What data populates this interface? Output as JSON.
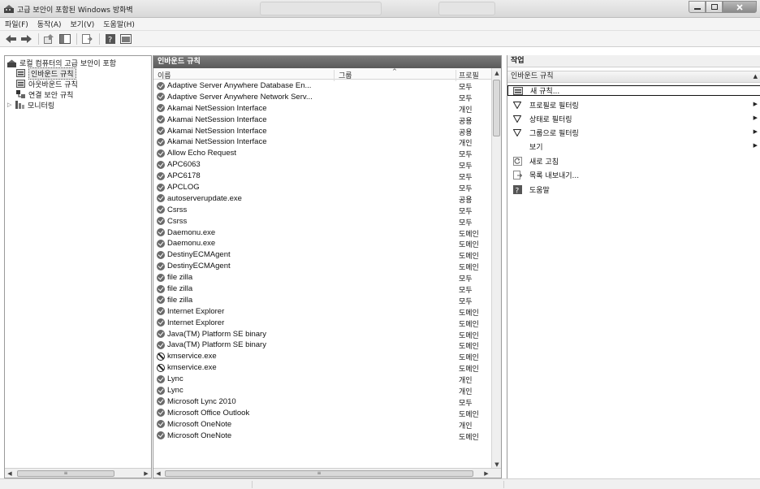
{
  "window": {
    "title": "고급 보안이 포함된 Windows 방화벽",
    "controls": [
      "minimize",
      "maximize",
      "close"
    ]
  },
  "menu": [
    "파일(F)",
    "동작(A)",
    "보기(V)",
    "도움말(H)"
  ],
  "toolbar": {
    "buttons": [
      "back-icon",
      "forward-icon",
      "up-icon",
      "show-hide-tree-icon",
      "export-icon",
      "help-icon",
      "console-icon"
    ]
  },
  "tree": {
    "root": "로컬 컴퓨터의 고급 보안이 포함",
    "items": [
      {
        "label": "인바운드 규칙",
        "selected": true,
        "icon": "inbound-rules-icon"
      },
      {
        "label": "아웃바운드 규칙",
        "selected": false,
        "icon": "outbound-rules-icon"
      },
      {
        "label": "연결 보안 규칙",
        "selected": false,
        "icon": "connection-security-icon"
      },
      {
        "label": "모니터링",
        "selected": false,
        "icon": "monitoring-icon",
        "expandable": true
      }
    ]
  },
  "rules_pane": {
    "title": "인바운드 규칙",
    "columns": {
      "name": "이름",
      "group": "그룹",
      "profile": "프로필"
    },
    "rows": [
      {
        "name": "Adaptive Server Anywhere Database En...",
        "profile": "모두",
        "status": "allow"
      },
      {
        "name": "Adaptive Server Anywhere Network Serv...",
        "profile": "모두",
        "status": "allow"
      },
      {
        "name": "Akamai NetSession Interface",
        "profile": "개인",
        "status": "allow"
      },
      {
        "name": "Akamai NetSession Interface",
        "profile": "공용",
        "status": "allow"
      },
      {
        "name": "Akamai NetSession Interface",
        "profile": "공용",
        "status": "allow"
      },
      {
        "name": "Akamai NetSession Interface",
        "profile": "개인",
        "status": "allow"
      },
      {
        "name": "Allow Echo Request",
        "profile": "모두",
        "status": "allow"
      },
      {
        "name": "APC6063",
        "profile": "모두",
        "status": "allow"
      },
      {
        "name": "APC6178",
        "profile": "모두",
        "status": "allow"
      },
      {
        "name": "APCLOG",
        "profile": "모두",
        "status": "allow"
      },
      {
        "name": "autoserverupdate.exe",
        "profile": "공용",
        "status": "allow"
      },
      {
        "name": "Csrss",
        "profile": "모두",
        "status": "allow"
      },
      {
        "name": "Csrss",
        "profile": "모두",
        "status": "allow"
      },
      {
        "name": "Daemonu.exe",
        "profile": "도메인",
        "status": "allow"
      },
      {
        "name": "Daemonu.exe",
        "profile": "도메인",
        "status": "allow"
      },
      {
        "name": "DestinyECMAgent",
        "profile": "도메인",
        "status": "allow"
      },
      {
        "name": "DestinyECMAgent",
        "profile": "도메인",
        "status": "allow"
      },
      {
        "name": "file zilla",
        "profile": "모두",
        "status": "allow"
      },
      {
        "name": "file zilla",
        "profile": "모두",
        "status": "allow"
      },
      {
        "name": "file zilla",
        "profile": "모두",
        "status": "allow"
      },
      {
        "name": "Internet Explorer",
        "profile": "도메인",
        "status": "allow"
      },
      {
        "name": "Internet Explorer",
        "profile": "도메인",
        "status": "allow"
      },
      {
        "name": "Java(TM) Platform SE binary",
        "profile": "도메인",
        "status": "allow"
      },
      {
        "name": "Java(TM) Platform SE binary",
        "profile": "도메인",
        "status": "allow"
      },
      {
        "name": "kmservice.exe",
        "profile": "도메인",
        "status": "block"
      },
      {
        "name": "kmservice.exe",
        "profile": "도메인",
        "status": "block"
      },
      {
        "name": "Lync",
        "profile": "개인",
        "status": "allow"
      },
      {
        "name": "Lync",
        "profile": "개인",
        "status": "allow"
      },
      {
        "name": "Microsoft Lync 2010",
        "profile": "모두",
        "status": "allow"
      },
      {
        "name": "Microsoft Office Outlook",
        "profile": "도메인",
        "status": "allow"
      },
      {
        "name": "Microsoft OneNote",
        "profile": "개인",
        "status": "allow"
      },
      {
        "name": "Microsoft OneNote",
        "profile": "도메인",
        "status": "allow"
      }
    ]
  },
  "actions_pane": {
    "title": "작업",
    "section": "인바운드 규칙",
    "items": [
      {
        "label": "새 규칙...",
        "icon": "new-rule-icon",
        "submenu": false,
        "focused": true
      },
      {
        "label": "프로필로 필터링",
        "icon": "filter-icon",
        "submenu": true
      },
      {
        "label": "상태로 필터링",
        "icon": "filter-icon",
        "submenu": true
      },
      {
        "label": "그룹으로 필터링",
        "icon": "filter-icon",
        "submenu": true
      },
      {
        "label": "보기",
        "icon": "",
        "submenu": true
      },
      {
        "label": "새로 고침",
        "icon": "refresh-icon",
        "submenu": false
      },
      {
        "label": "목록 내보내기...",
        "icon": "export-list-icon",
        "submenu": false
      },
      {
        "label": "도움말",
        "icon": "help-icon",
        "submenu": false
      }
    ]
  }
}
